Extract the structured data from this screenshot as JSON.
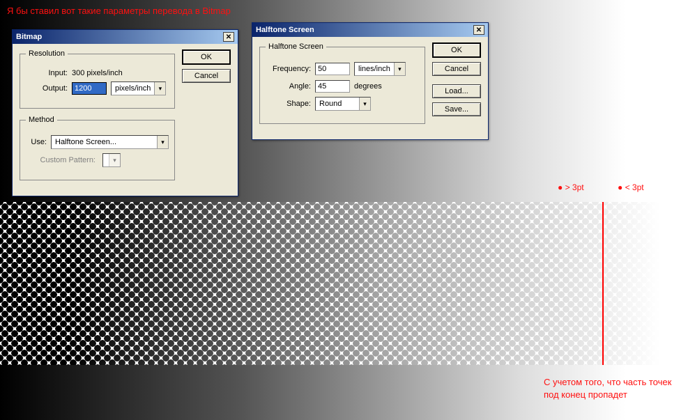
{
  "annotations": {
    "top": "Я бы ставил вот такие параметры перевода в Bitmap",
    "pt_gt": "● > 3pt",
    "pt_lt": "● < 3pt",
    "bottom_l1": "С учетом того, что часть точек",
    "bottom_l2": "под конец пропадет"
  },
  "bitmap_dialog": {
    "title": "Bitmap",
    "resolution": {
      "legend": "Resolution",
      "input_label": "Input:",
      "input_value": "300 pixels/inch",
      "output_label": "Output:",
      "output_value": "1200",
      "output_units": "pixels/inch"
    },
    "method": {
      "legend": "Method",
      "use_label": "Use:",
      "use_value": "Halftone Screen...",
      "custom_label": "Custom Pattern:"
    },
    "buttons": {
      "ok": "OK",
      "cancel": "Cancel"
    }
  },
  "halftone_dialog": {
    "title": "Halftone Screen",
    "group": {
      "legend": "Halftone Screen",
      "freq_label": "Frequency:",
      "freq_value": "50",
      "freq_units": "lines/inch",
      "angle_label": "Angle:",
      "angle_value": "45",
      "angle_units": "degrees",
      "shape_label": "Shape:",
      "shape_value": "Round"
    },
    "buttons": {
      "ok": "OK",
      "cancel": "Cancel",
      "load": "Load...",
      "save": "Save..."
    }
  }
}
